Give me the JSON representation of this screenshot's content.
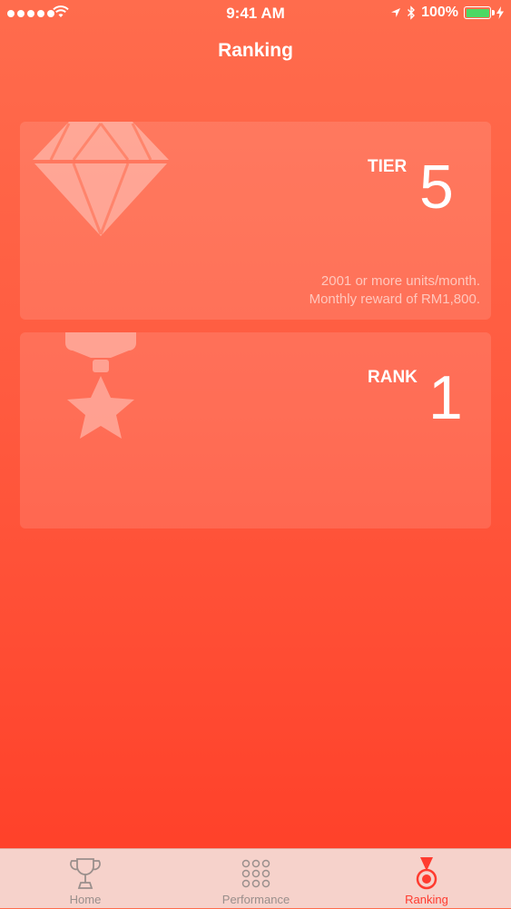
{
  "status_bar": {
    "time": "9:41 AM",
    "battery": "100%",
    "battery_level": 1.0,
    "battery_color": "#4cd964"
  },
  "nav": {
    "title": "Ranking"
  },
  "tier_card": {
    "label": "TIER",
    "value": "5",
    "icon": "diamond-icon",
    "desc_line1": "2001 or more units/month.",
    "desc_line2": "Monthly reward of RM1,800."
  },
  "rank_card": {
    "label": "RANK",
    "value": "1",
    "icon": "star-medal-icon"
  },
  "tab_bar": {
    "tabs": [
      {
        "label": "Home",
        "icon": "trophy-icon",
        "active": false
      },
      {
        "label": "Performance",
        "icon": "grid-dots-icon",
        "active": false
      },
      {
        "label": "Ranking",
        "icon": "medal-icon",
        "active": true
      }
    ],
    "active_color": "#ff3b2f"
  }
}
